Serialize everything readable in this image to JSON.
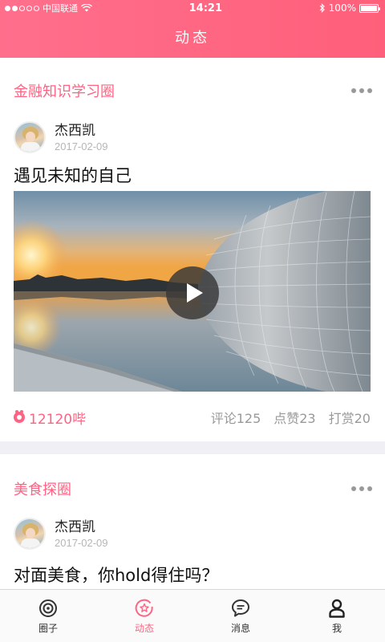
{
  "status_bar": {
    "carrier": "中国联通",
    "time": "14:21",
    "battery": "100%"
  },
  "nav": {
    "title": "动态"
  },
  "posts": [
    {
      "circle": "金融知识学习圈",
      "author": "杰西凯",
      "date": "2017-02-09",
      "title": "遇见未知的自己",
      "coins": "12120哔",
      "comments": "评论125",
      "likes": "点赞23",
      "rewards": "打赏20"
    },
    {
      "circle": "美食探圈",
      "author": "杰西凯",
      "date": "2017-02-09",
      "title": "对面美食，你hold得住吗？"
    }
  ],
  "tabs": [
    {
      "label": "圈子",
      "icon": "circle-icon"
    },
    {
      "label": "动态",
      "icon": "feed-star-icon",
      "active": true
    },
    {
      "label": "消息",
      "icon": "message-icon"
    },
    {
      "label": "我",
      "icon": "profile-icon"
    }
  ],
  "colors": {
    "accent": "#ff6383",
    "header": "#ff6f8c"
  }
}
